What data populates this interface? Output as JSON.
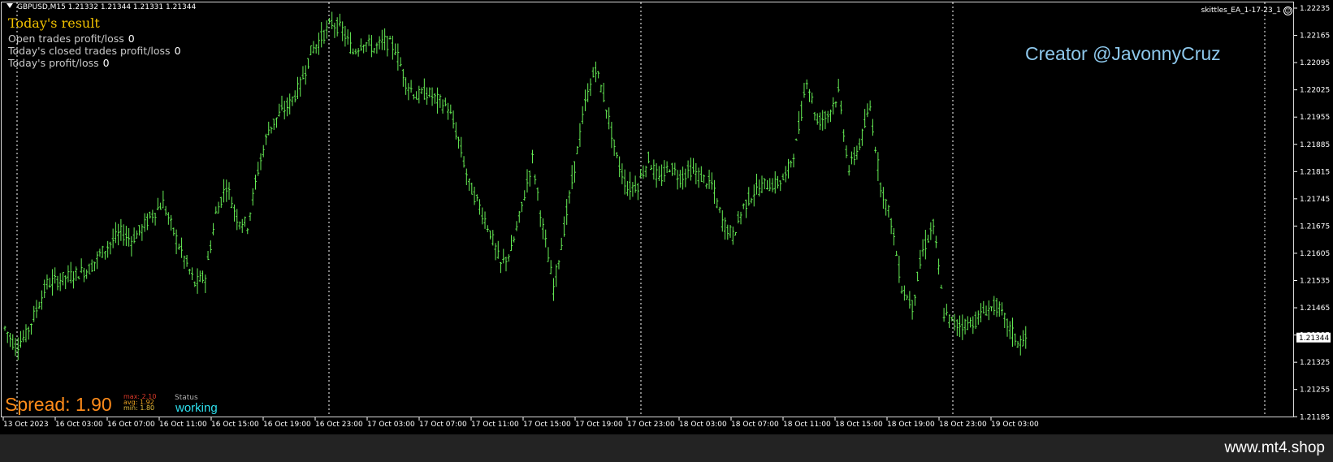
{
  "chart": {
    "symbol_info": "GBPUSD,M15  1.21332 1.21344 1.21331 1.21344",
    "ea_label": "skittles_EA_1-17-23_1",
    "bar_color": "#66ee55",
    "current_price": "1.21344"
  },
  "result_panel": {
    "title": "Today's result",
    "rows": [
      {
        "label": "Open trades profit/loss",
        "value": "0"
      },
      {
        "label": "Today's closed trades profit/loss",
        "value": "0"
      },
      {
        "label": "Today's profit/loss",
        "value": "0"
      }
    ]
  },
  "creator_text": "Creator @JavonnyCruz",
  "spread": {
    "label": "Spread: 1.90",
    "max": "max: 2.10",
    "avg": "avg: 1.92",
    "min": "min: 1.80"
  },
  "status": {
    "caption": "Status",
    "value": "working"
  },
  "footer_url": "www.mt4.shop",
  "chart_data": {
    "type": "bar",
    "title": "GBPUSD,M15",
    "x_ticks": [
      "13 Oct 2023",
      "16 Oct 03:00",
      "16 Oct 07:00",
      "16 Oct 11:00",
      "16 Oct 15:00",
      "16 Oct 19:00",
      "16 Oct 23:00",
      "17 Oct 03:00",
      "17 Oct 07:00",
      "17 Oct 11:00",
      "17 Oct 15:00",
      "17 Oct 19:00",
      "17 Oct 23:00",
      "18 Oct 03:00",
      "18 Oct 07:00",
      "18 Oct 11:00",
      "18 Oct 15:00",
      "18 Oct 19:00",
      "18 Oct 23:00",
      "19 Oct 03:00"
    ],
    "y_ticks": [
      "1.22235",
      "1.22165",
      "1.22095",
      "1.22025",
      "1.21955",
      "1.21885",
      "1.21815",
      "1.21745",
      "1.21675",
      "1.21605",
      "1.21535",
      "1.21465",
      "1.21395",
      "1.21325",
      "1.21255",
      "1.21185"
    ],
    "ylim": [
      1.2118,
      1.2224
    ],
    "grid": "vertical day separators",
    "series": [
      {
        "values": [
          1.2137,
          1.2132,
          1.2135,
          1.2142,
          1.2149,
          1.215,
          1.2151,
          1.2152,
          1.2153,
          1.2157,
          1.216,
          1.2163,
          1.2161,
          1.2164,
          1.2168,
          1.2171,
          1.2163,
          1.2156,
          1.2149,
          1.2151,
          1.2168,
          1.2176,
          1.2167,
          1.2165,
          1.218,
          1.2191,
          1.2195,
          1.2198,
          1.2203,
          1.2212,
          1.2216,
          1.222,
          1.2218,
          1.2212,
          1.2215,
          1.2213,
          1.2215,
          1.2213,
          1.2204,
          1.22,
          1.2201,
          1.2199,
          1.2197,
          1.2188,
          1.2176,
          1.217,
          1.2163,
          1.2154,
          1.2158,
          1.217,
          1.2183,
          1.2164,
          1.2148,
          1.2164,
          1.2181,
          1.2198,
          1.2208,
          1.2197,
          1.2183,
          1.2175,
          1.2176,
          1.2183,
          1.2177,
          1.2181,
          1.2178,
          1.218,
          1.2178,
          1.2176,
          1.2166,
          1.2162,
          1.217,
          1.2174,
          1.2176,
          1.2176,
          1.2178,
          1.2187,
          1.2205,
          1.2193,
          1.2195,
          1.2201,
          1.218,
          1.2187,
          1.2197,
          1.2176,
          1.2166,
          1.2148,
          1.2143,
          1.2158,
          1.2165,
          1.2141,
          1.2138,
          1.2138,
          1.2139,
          1.2142,
          1.2143,
          1.2138,
          1.2133,
          1.2134
        ]
      }
    ]
  }
}
